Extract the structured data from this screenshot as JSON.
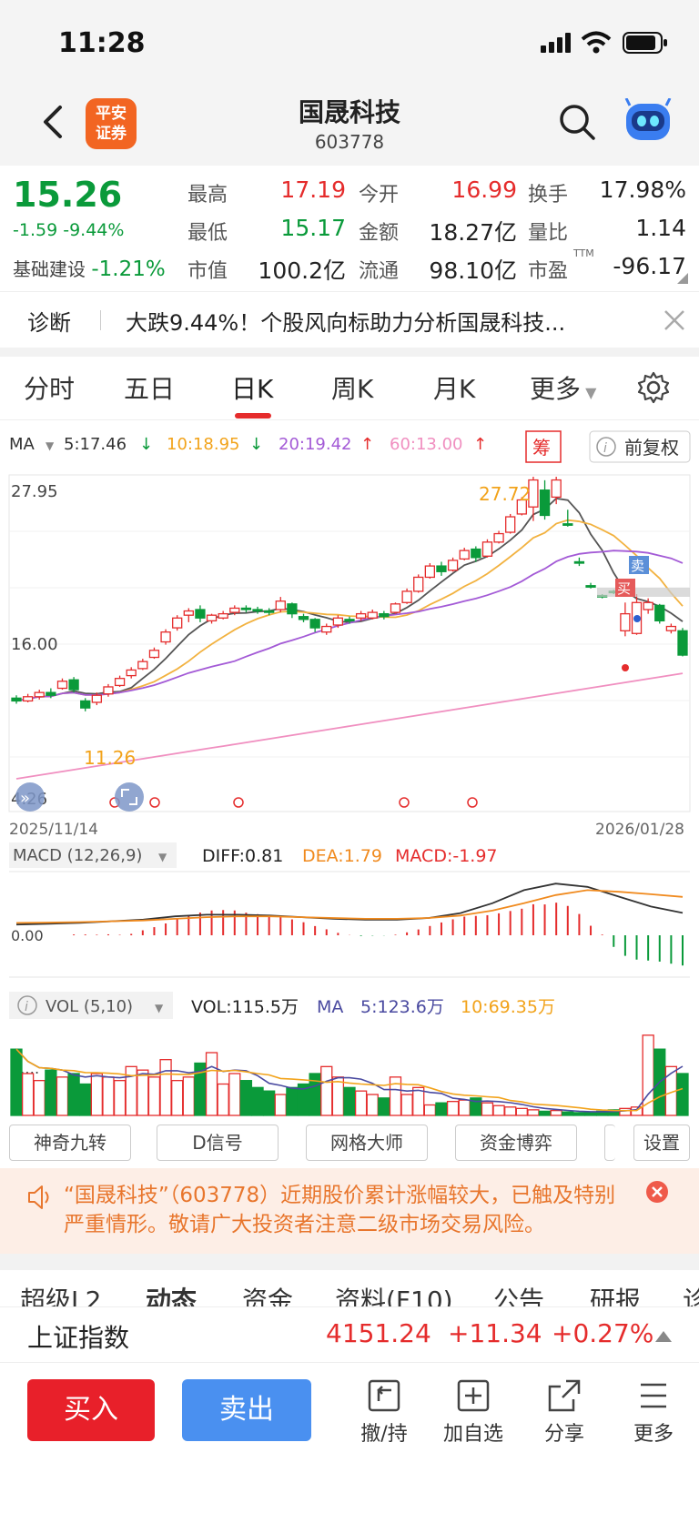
{
  "status": {
    "time": "11:28"
  },
  "header": {
    "logo": "平安证券",
    "title": "国晟科技",
    "code": "603778"
  },
  "quote": {
    "price": "15.26",
    "change": "-1.59",
    "change_pct": "-9.44%",
    "sector_name": "基础建设",
    "sector_pct": "-1.21%",
    "fields": [
      {
        "label": "最高",
        "value": "17.19"
      },
      {
        "label": "今开",
        "value": "16.99"
      },
      {
        "label": "换手",
        "value": "17.98%"
      },
      {
        "label": "最低",
        "value": "15.17"
      },
      {
        "label": "金额",
        "value": "18.27亿"
      },
      {
        "label": "量比",
        "value": "1.14"
      },
      {
        "label": "市值",
        "value": "100.2亿"
      },
      {
        "label": "流通",
        "value": "98.10亿"
      },
      {
        "label": "市盈",
        "value": "-96.17"
      }
    ],
    "pe_tag": "TTM"
  },
  "diagnosis": {
    "label": "诊断",
    "text": "大跌9.44%！个股风向标助力分析国晟科技..."
  },
  "tabs": [
    "分时",
    "五日",
    "日K",
    "周K",
    "月K",
    "更多"
  ],
  "ma": {
    "label": "MA",
    "ma5": "5:17.46",
    "ma10": "10:18.95",
    "ma20": "20:19.42",
    "ma60": "60:13.00",
    "chip_label": "筹",
    "adjust_label": "前复权"
  },
  "kline": {
    "y_high": "27.95",
    "y_mid": "16.00",
    "y_low": "4.26",
    "peak_label": "27.72",
    "low_label": "11.26",
    "date_start": "2025/11/14",
    "date_end": "2026/01/28",
    "sell_tag": "卖",
    "buy_tag": "买"
  },
  "macd": {
    "label": "MACD (12,26,9)",
    "diff": "DIFF:0.81",
    "dea": "DEA:1.79",
    "macd": "MACD:-1.97",
    "zero": "0.00"
  },
  "vol": {
    "label": "VOL (5,10)",
    "vol": "VOL:115.5万",
    "ma_label": "MA",
    "ma5": "5:123.6万",
    "ma10": "10:69.35万",
    "axis": "1.…"
  },
  "tools": [
    "神奇九转",
    "D信号",
    "网格大师",
    "资金博弈",
    "设置"
  ],
  "warning": "“国晟科技”（603778）近期股价累计涨幅较大，已触及特别严重情形。敬请广大投资者注意二级市场交易风险。",
  "bottom_tabs": [
    "超级L2",
    "动态",
    "资金",
    "资料(F10)",
    "公告",
    "研报",
    "诊"
  ],
  "index": {
    "name": "上证指数",
    "value": "4151.24",
    "change": "+11.34",
    "pct": "+0.27%"
  },
  "actions": {
    "buy": "买入",
    "sell": "卖出",
    "items": [
      "撤/持",
      "加自选",
      "分享",
      "更多"
    ]
  },
  "colors": {
    "up": "#e52c2c",
    "down": "#0a9a3a",
    "accent": "#4a90f0"
  },
  "chart_data": {
    "type": "candlestick",
    "ylim": [
      4.26,
      27.95
    ],
    "candles": [
      [
        12.2,
        12.0,
        12.4,
        11.8
      ],
      [
        12.0,
        12.3,
        12.5,
        11.9
      ],
      [
        12.3,
        12.6,
        12.8,
        12.1
      ],
      [
        12.6,
        12.4,
        12.9,
        12.2
      ],
      [
        12.9,
        13.4,
        13.6,
        12.8
      ],
      [
        13.5,
        12.8,
        13.7,
        12.6
      ],
      [
        12.0,
        11.5,
        12.2,
        11.26
      ],
      [
        11.9,
        12.4,
        12.6,
        11.7
      ],
      [
        12.5,
        13.0,
        13.2,
        12.3
      ],
      [
        13.1,
        13.6,
        13.8,
        13.0
      ],
      [
        13.8,
        14.2,
        14.4,
        13.6
      ],
      [
        14.3,
        14.8,
        15.0,
        14.2
      ],
      [
        15.1,
        15.6,
        15.8,
        15.0
      ],
      [
        16.2,
        16.9,
        17.1,
        16.0
      ],
      [
        17.2,
        17.9,
        18.1,
        17.0
      ],
      [
        18.1,
        18.4,
        18.6,
        17.6
      ],
      [
        18.5,
        17.9,
        18.8,
        17.6
      ],
      [
        17.7,
        18.1,
        18.2,
        17.5
      ],
      [
        17.9,
        18.2,
        18.4,
        17.8
      ],
      [
        18.3,
        18.6,
        18.8,
        18.1
      ],
      [
        18.6,
        18.5,
        18.8,
        18.3
      ],
      [
        18.5,
        18.4,
        18.7,
        18.2
      ],
      [
        18.4,
        18.3,
        18.6,
        18.1
      ],
      [
        18.5,
        19.1,
        19.4,
        18.3
      ],
      [
        18.9,
        18.2,
        19.0,
        17.9
      ],
      [
        18.0,
        17.8,
        18.2,
        17.6
      ],
      [
        17.8,
        17.2,
        17.9,
        16.9
      ],
      [
        16.9,
        17.3,
        17.5,
        16.7
      ],
      [
        17.4,
        17.9,
        18.1,
        17.2
      ],
      [
        17.8,
        17.7,
        18.0,
        17.5
      ],
      [
        17.9,
        18.2,
        18.4,
        17.7
      ],
      [
        17.9,
        18.3,
        18.5,
        17.8
      ],
      [
        18.2,
        18.0,
        18.4,
        17.8
      ],
      [
        18.3,
        18.9,
        19.0,
        18.2
      ],
      [
        19.0,
        19.8,
        20.0,
        18.9
      ],
      [
        19.8,
        20.8,
        21.0,
        19.7
      ],
      [
        20.8,
        21.6,
        21.8,
        20.7
      ],
      [
        21.6,
        21.2,
        21.9,
        20.9
      ],
      [
        21.3,
        22.0,
        22.2,
        21.2
      ],
      [
        22.1,
        22.7,
        22.9,
        22.0
      ],
      [
        22.8,
        22.2,
        23.0,
        21.9
      ],
      [
        22.3,
        23.3,
        23.5,
        22.2
      ],
      [
        23.3,
        23.9,
        24.1,
        23.2
      ],
      [
        24.0,
        25.1,
        25.3,
        23.9
      ],
      [
        25.3,
        26.3,
        26.5,
        25.2
      ],
      [
        25.8,
        27.72,
        27.95,
        24.8
      ],
      [
        27.0,
        25.2,
        27.7,
        24.9
      ],
      [
        26.5,
        27.72,
        27.95,
        26.0
      ],
      [
        24.6,
        24.5,
        25.6,
        24.4
      ],
      [
        21.9,
        21.8,
        22.2,
        21.6
      ],
      [
        20.2,
        20.1,
        20.4,
        20.0
      ],
      [
        19.5,
        19.4,
        19.6,
        19.3
      ],
      [
        19.8,
        19.7,
        19.9,
        19.6
      ],
      [
        16.99,
        18.2,
        19.0,
        16.6
      ],
      [
        16.8,
        19.0,
        19.6,
        16.7
      ],
      [
        18.5,
        19.0,
        19.3,
        18.2
      ],
      [
        18.8,
        17.7,
        18.9,
        17.5
      ],
      [
        17.0,
        17.3,
        17.5,
        16.8
      ],
      [
        16.99,
        15.26,
        17.19,
        15.17
      ]
    ],
    "macd_diff": [
      0.1,
      0.15,
      0.2,
      0.3,
      0.4,
      0.6,
      0.7,
      0.7,
      0.65,
      0.55,
      0.45,
      0.4,
      0.4,
      0.5,
      0.8,
      1.4,
      2.2,
      2.6,
      2.4,
      1.8,
      1.2,
      0.81
    ],
    "macd_dea": [
      0.2,
      0.22,
      0.25,
      0.3,
      0.35,
      0.45,
      0.55,
      0.6,
      0.6,
      0.55,
      0.5,
      0.45,
      0.45,
      0.5,
      0.65,
      0.95,
      1.4,
      1.9,
      2.2,
      2.1,
      1.95,
      1.79
    ],
    "volume": [
      95,
      60,
      50,
      65,
      55,
      60,
      45,
      60,
      55,
      50,
      70,
      65,
      55,
      80,
      50,
      55,
      75,
      90,
      45,
      60,
      50,
      40,
      35,
      30,
      40,
      45,
      60,
      70,
      55,
      40,
      35,
      30,
      25,
      55,
      30,
      40,
      15,
      18,
      20,
      22,
      25,
      18,
      14,
      12,
      10,
      8,
      6,
      7,
      5,
      4,
      5,
      6,
      8,
      10,
      12,
      115,
      95,
      70,
      60
    ]
  }
}
